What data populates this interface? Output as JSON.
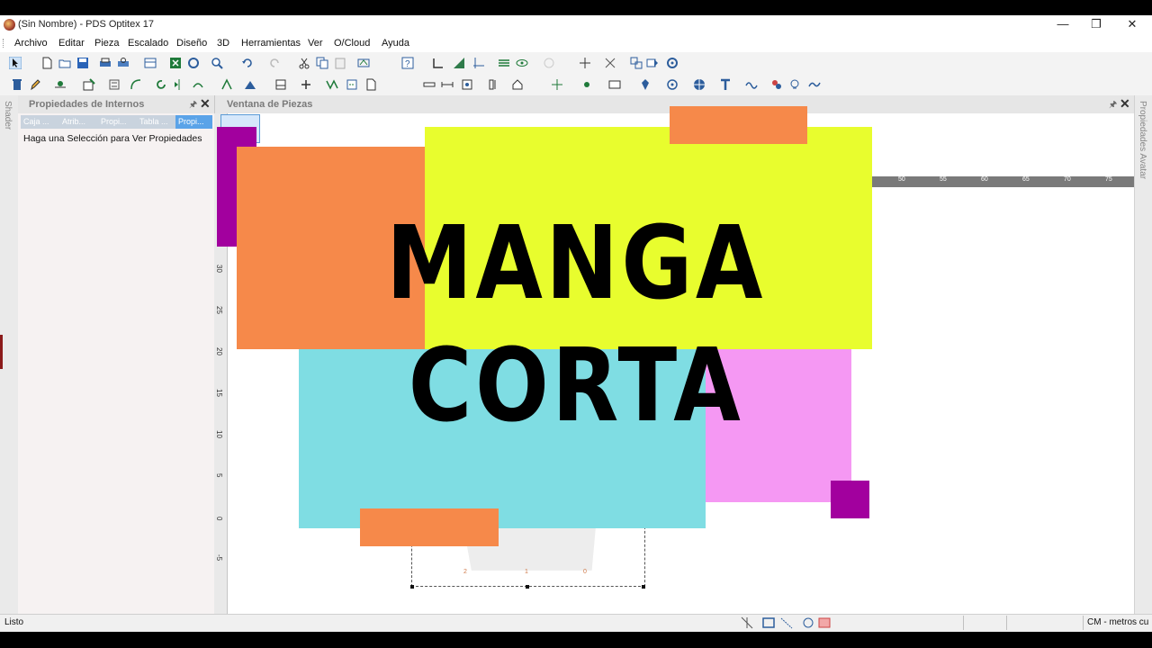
{
  "window": {
    "title": "(Sin Nombre) - PDS Optitex 17",
    "minimize_glyph": "—",
    "maximize_glyph": "❐",
    "close_glyph": "✕"
  },
  "menu": [
    "Archivo",
    "Editar",
    "Pieza",
    "Escalado",
    "Diseño",
    "3D",
    "Herramientas",
    "Ver",
    "O/Cloud",
    "Ayuda"
  ],
  "side_strips": {
    "left": "Shader",
    "right": "Propiedades Avatar"
  },
  "properties_panel": {
    "title": "Propiedades de Internos",
    "tabs": [
      "Caja ...",
      "Atrib...",
      "Propi...",
      "Tabla ...",
      "Propi..."
    ],
    "active_tab_index": 4,
    "message": "Haga una Selección para Ver Propiedades"
  },
  "pieces_window": {
    "title": "Ventana de Piezas",
    "h_ruler_ticks": [
      "50",
      "55",
      "60",
      "65",
      "70",
      "75"
    ],
    "v_ruler_ticks": [
      "30",
      "25",
      "20",
      "15",
      "10",
      "5",
      "0",
      "-5"
    ],
    "piece_labels": [
      "2",
      "1",
      "0"
    ]
  },
  "overlay": {
    "line1": "MANGA",
    "line2": "CORTA",
    "colors": {
      "yellow": "#e8fd2e",
      "orange": "#f6894a",
      "cyan": "#7fdde3",
      "pink": "#f598f3",
      "purple": "#a2009e"
    }
  },
  "status_bar": {
    "text": "Listo",
    "units": "CM - metros cu"
  },
  "icons": [
    "pointer-icon",
    "new-file-icon",
    "open-folder-icon",
    "save-icon",
    "print-icon",
    "excel-icon",
    "zoom-icon",
    "undo-icon",
    "redo-icon",
    "cut-icon",
    "copy-icon",
    "paste-icon",
    "help-icon",
    "trash-icon",
    "text-icon",
    "globe-icon"
  ]
}
